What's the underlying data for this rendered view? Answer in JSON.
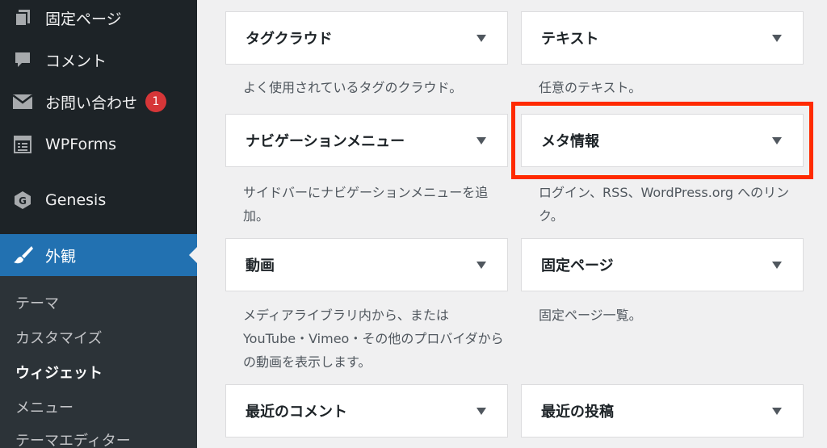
{
  "sidebar": {
    "items": [
      {
        "label": "固定ページ",
        "icon": "pages-icon"
      },
      {
        "label": "コメント",
        "icon": "comments-icon"
      },
      {
        "label": "お問い合わせ",
        "icon": "mail-icon",
        "badge": "1"
      },
      {
        "label": "WPForms",
        "icon": "wpforms-icon"
      },
      {
        "label": "Genesis",
        "icon": "genesis-icon"
      },
      {
        "label": "外観",
        "icon": "appearance-brush-icon"
      }
    ],
    "submenu": [
      "テーマ",
      "カスタマイズ",
      "ウィジェット",
      "メニュー",
      "テーマエディター"
    ]
  },
  "widgets": [
    {
      "title": "タグクラウド",
      "description": "よく使用されているタグのクラウド。"
    },
    {
      "title": "テキスト",
      "description": "任意のテキスト。"
    },
    {
      "title": "ナビゲーションメニュー",
      "description": "サイドバーにナビゲーションメニューを追加。"
    },
    {
      "title": "メタ情報",
      "description": "ログイン、RSS、WordPress.org へのリンク。"
    },
    {
      "title": "動画",
      "description": "メディアライブラリ内から、または YouTube・Vimeo・その他のプロバイダからの動画を表示します。"
    },
    {
      "title": "固定ページ",
      "description": "固定ページ一覧。"
    },
    {
      "title": "最近のコメント",
      "description": ""
    },
    {
      "title": "最近の投稿",
      "description": ""
    }
  ],
  "colors": {
    "sidebar_bg": "#1d2327",
    "submenu_bg": "#2c3338",
    "active_bg": "#2271b1",
    "badge": "#d63638",
    "highlight": "#ff2a00"
  }
}
